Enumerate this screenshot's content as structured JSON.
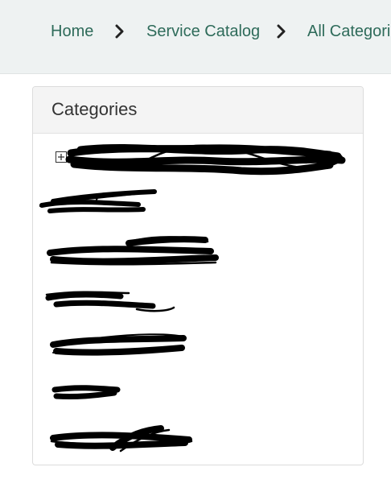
{
  "breadcrumb": {
    "items": [
      {
        "label": "Home"
      },
      {
        "label": "Service Catalog"
      },
      {
        "label": "All Categories"
      }
    ]
  },
  "categories": {
    "title": "Categories",
    "items": [
      {
        "label": "",
        "redacted": true,
        "expandable": true
      },
      {
        "label": "",
        "redacted": true
      },
      {
        "label": "",
        "redacted": true
      },
      {
        "label": "",
        "redacted": true
      },
      {
        "label": "",
        "redacted": true
      },
      {
        "label": "",
        "redacted": true
      },
      {
        "label": "",
        "redacted": true
      }
    ]
  },
  "colors": {
    "link": "#2e6b5a",
    "topbar_bg": "#eef2f2",
    "panel_header_bg": "#f4f4f4",
    "redaction": "#000000"
  },
  "icons": {
    "breadcrumb_separator": "chevron-right-icon",
    "expand": "plus-box-icon"
  }
}
